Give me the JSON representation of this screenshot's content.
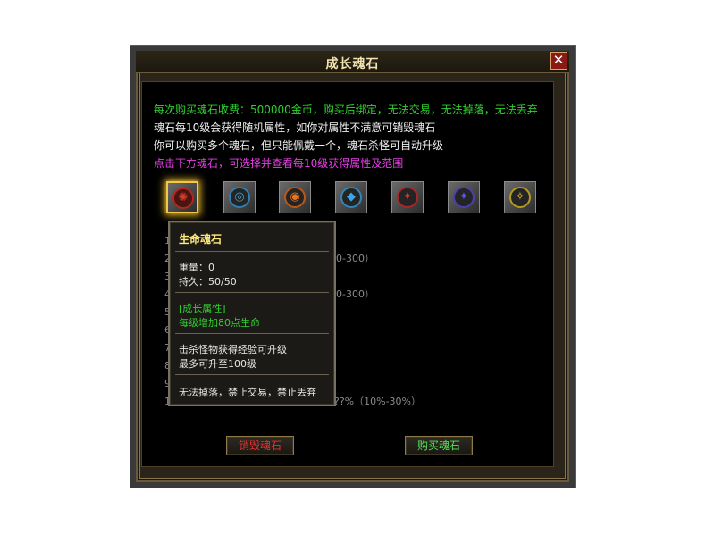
{
  "window": {
    "title": "成长魂石",
    "close_label": "✕"
  },
  "info": {
    "line1": "每次购买魂石收费：500000金币，购买后绑定，无法交易，无法掉落，无法丢弃",
    "line2": "魂石每10级会获得随机属性，如你对属性不满意可销毁魂石",
    "line3": "你可以购买多个魂石，但只能佩戴一个，魂石杀怪可自动升级",
    "line4": "点击下方魂石，可选择并查看每10级获得属性及范围"
  },
  "colors": {
    "stone1": "#e03a2c",
    "stone2": "#3a9fd6",
    "stone3": "#e8751a",
    "stone4": "#3aa6e6",
    "stone5": "#e33232",
    "stone6": "#5b52e6",
    "stone7": "#e8c62a"
  },
  "icons": {
    "stone1": "life-stone-icon",
    "stone2": "swirl-stone-icon",
    "stone3": "flame-stone-icon",
    "stone4": "water-stone-icon",
    "stone5": "red-rune-stone-icon",
    "stone6": "blue-rune-stone-icon",
    "stone7": "gold-rune-stone-icon"
  },
  "background_rows": {
    "r1": "1",
    "r2": "2",
    "r2_tail": "0-300）",
    "r3": "3",
    "r4": "4",
    "r4_tail": "0-300）",
    "r5": "5",
    "r6": "6",
    "r7": "7",
    "r8": "8",
    "r9": "9",
    "r10": "1",
    "r10_tail": "??%（10%-30%）"
  },
  "tooltip": {
    "name": "生命魂石",
    "weight": "重量：0",
    "durability": "持久：50/50",
    "growth_header": "[成长属性]",
    "growth_value": "每级增加80点生命",
    "upgrade_line1": "击杀怪物获得经验可升级",
    "upgrade_line2": "最多可升至100级",
    "restriction": "无法掉落，禁止交易，禁止丢弃"
  },
  "buttons": {
    "destroy": "销毁魂石",
    "buy": "购买魂石"
  }
}
